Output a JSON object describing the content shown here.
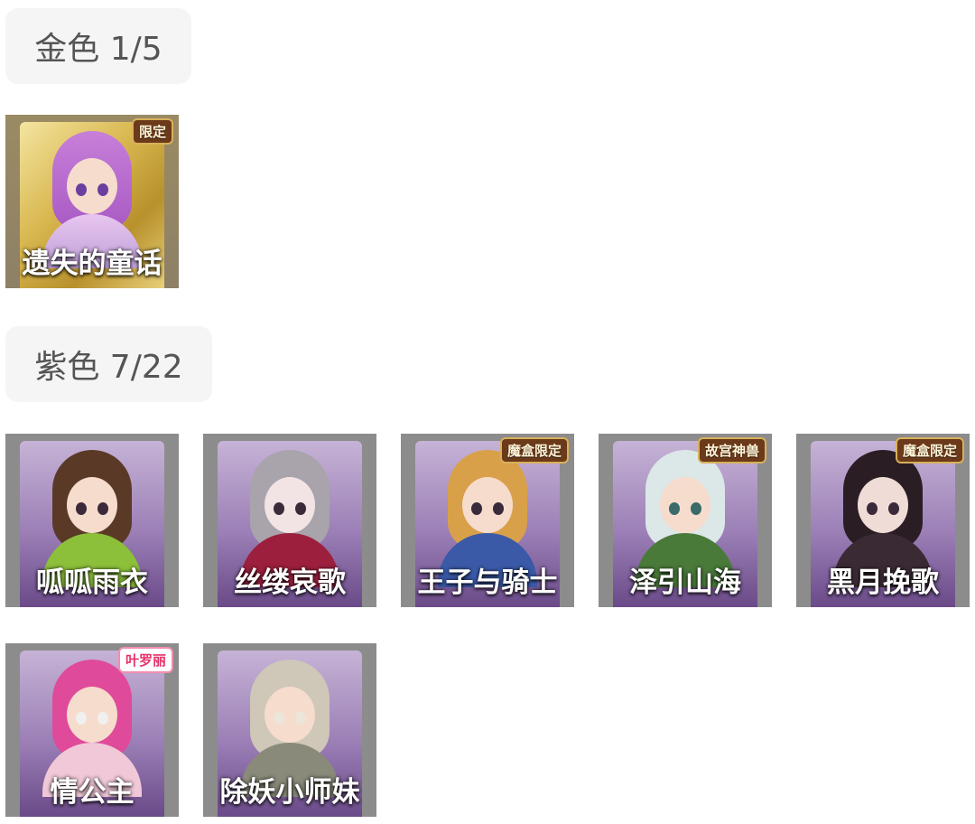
{
  "sections": {
    "gold": {
      "title": "金色 1/5",
      "items": [
        {
          "name": "遗失的童话",
          "badge": "限定"
        }
      ]
    },
    "purple": {
      "title": "紫色 7/22",
      "items": [
        {
          "name": "呱呱雨衣",
          "badge": ""
        },
        {
          "name": "丝缕哀歌",
          "badge": ""
        },
        {
          "name": "王子与骑士",
          "badge": "魔盒限定"
        },
        {
          "name": "泽引山海",
          "badge": "故宫神兽"
        },
        {
          "name": "黑月挽歌",
          "badge": "魔盒限定"
        },
        {
          "name": "情公主",
          "badge": "叶罗丽"
        },
        {
          "name": "除妖小师妹",
          "badge": ""
        }
      ]
    }
  },
  "colors": {
    "chip_bg": "#f5f5f5",
    "chip_text": "#555555",
    "gold_card": "#d8b74f",
    "purple_card": "#9b7fb6",
    "card_frame": "#8c8c8c"
  }
}
